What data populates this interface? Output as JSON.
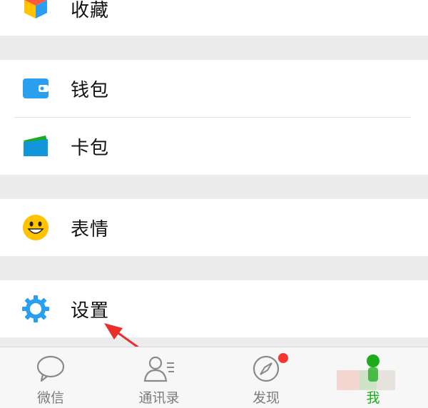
{
  "menu": {
    "favorites": {
      "label": "收藏",
      "icon": "favorites-cube-icon"
    },
    "wallet": {
      "label": "钱包",
      "icon": "wallet-icon"
    },
    "cards": {
      "label": "卡包",
      "icon": "card-pack-icon"
    },
    "stickers": {
      "label": "表情",
      "icon": "smiley-icon"
    },
    "settings": {
      "label": "设置",
      "icon": "gear-icon"
    }
  },
  "tabbar": {
    "chats": {
      "label": "微信",
      "icon": "chat-bubble-icon"
    },
    "contacts": {
      "label": "通讯录",
      "icon": "contacts-icon"
    },
    "discover": {
      "label": "发现",
      "icon": "compass-icon",
      "has_badge": true
    },
    "me": {
      "label": "我",
      "icon": "person-icon",
      "active": true
    }
  },
  "colors": {
    "accent_green": "#1aad19",
    "wallet_blue": "#2a9ff0",
    "card_blue": "#1296db",
    "smiley_yellow": "#ffc300",
    "gear_blue": "#2a9ff0",
    "badge_red": "#f43530",
    "annotation_red": "#e8302a"
  }
}
